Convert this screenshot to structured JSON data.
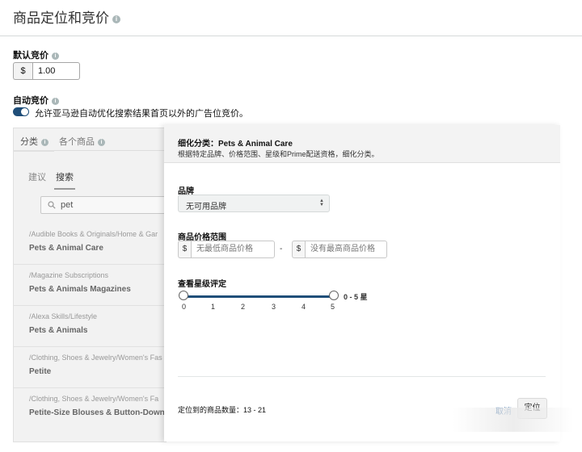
{
  "header": {
    "title": "商品定位和竞价",
    "info_icon": "info-icon"
  },
  "default_bid": {
    "label": "默认竞价",
    "currency": "$",
    "value": "1.00"
  },
  "auto_bid": {
    "label": "自动竞价",
    "toggle_on": true,
    "description": "允许亚马逊自动优化搜索结果首页以外的广告位竞价。"
  },
  "left_panel": {
    "tabs": [
      {
        "label": "分类"
      },
      {
        "label": "各个商品"
      }
    ],
    "subtabs": [
      {
        "label": "建议"
      },
      {
        "label": "搜索"
      }
    ],
    "search": {
      "value": "pet",
      "icon": "search-icon"
    },
    "results": [
      {
        "path": "/Audible Books & Originals/Home & Gar",
        "name": "Pets & Animal Care"
      },
      {
        "path": "/Magazine Subscriptions",
        "name": "Pets & Animals Magazines"
      },
      {
        "path": "/Alexa Skills/Lifestyle",
        "name": "Pets & Animals"
      },
      {
        "path": "/Clothing, Shoes & Jewelry/Women's Fas",
        "name": "Petite"
      },
      {
        "path": "/Clothing, Shoes & Jewelry/Women's Fa",
        "name": "Petite-Size Blouses & Button-Down S"
      }
    ]
  },
  "refine_panel": {
    "title": "细化分类：Pets & Animal Care",
    "subtitle": "根据特定品牌、价格范围、星级和Prime配送资格，细化分类。",
    "brand": {
      "label": "品牌",
      "selected": "无可用品牌"
    },
    "price": {
      "label": "商品价格范围",
      "currency": "$",
      "min_placeholder": "无最低商品价格",
      "dash": "-",
      "max_placeholder": "没有最高商品价格"
    },
    "rating": {
      "label": "查看星级评定",
      "range_text": "0 - 5 星",
      "min": 0,
      "max": 5,
      "ticks": [
        "0",
        "1",
        "2",
        "3",
        "4",
        "5"
      ]
    },
    "count_text": "定位到的商品数量：13 - 21",
    "cancel_label": "取消",
    "confirm_label": "定位"
  },
  "colors": {
    "accent": "#1f4e79",
    "link": "#1f5a99"
  }
}
